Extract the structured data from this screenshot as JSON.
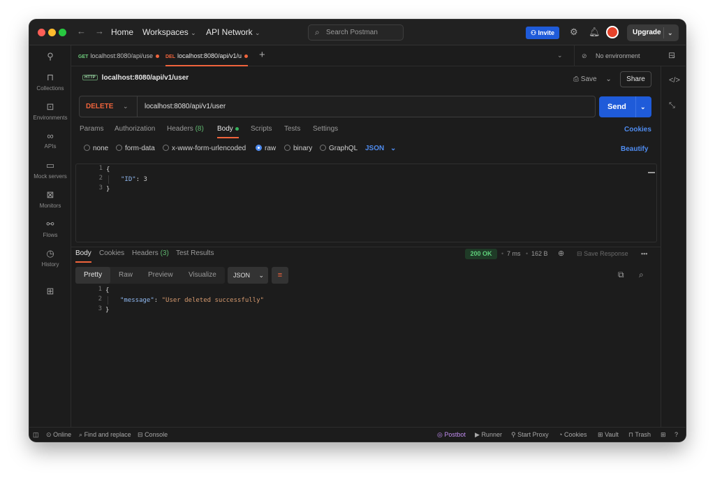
{
  "titlebar": {
    "home": "Home",
    "workspaces": "Workspaces",
    "api_network": "API Network",
    "search_placeholder": "Search Postman",
    "invite": "Invite",
    "upgrade": "Upgrade"
  },
  "sidebar": {
    "items": [
      {
        "label": "Collections"
      },
      {
        "label": "Environments"
      },
      {
        "label": "APIs"
      },
      {
        "label": "Mock servers"
      },
      {
        "label": "Monitors"
      },
      {
        "label": "Flows"
      },
      {
        "label": "History"
      }
    ]
  },
  "tabs": [
    {
      "method": "GET",
      "label": "localhost:8080/api/use"
    },
    {
      "method": "DEL",
      "label": "localhost:8080/api/v1/u"
    }
  ],
  "environment": "No environment",
  "request": {
    "title": "localhost:8080/api/v1/user",
    "title_chip": "HTTP",
    "save": "Save",
    "share": "Share",
    "method": "DELETE",
    "url": "localhost:8080/api/v1/user",
    "send": "Send"
  },
  "request_tabs": {
    "params": "Params",
    "authorization": "Authorization",
    "headers": "Headers",
    "headers_count": "(8)",
    "body": "Body",
    "scripts": "Scripts",
    "tests": "Tests",
    "settings": "Settings",
    "cookies": "Cookies"
  },
  "body_modes": {
    "none": "none",
    "form_data": "form-data",
    "urlencoded": "x-www-form-urlencoded",
    "raw": "raw",
    "binary": "binary",
    "graphql": "GraphQL",
    "format": "JSON",
    "beautify": "Beautify"
  },
  "request_body": {
    "lines": [
      "1",
      "2",
      "3"
    ],
    "open": "{",
    "key": "\"ID\"",
    "colon": ": ",
    "value": "3",
    "close": "}"
  },
  "response_tabs": {
    "body": "Body",
    "cookies": "Cookies",
    "headers": "Headers",
    "headers_count": "(3)",
    "test_results": "Test Results",
    "status": "200 OK",
    "time": "7 ms",
    "size": "162 B",
    "save_response": "Save Response"
  },
  "response_view": {
    "pretty": "Pretty",
    "raw": "Raw",
    "preview": "Preview",
    "visualize": "Visualize",
    "format": "JSON"
  },
  "response_body": {
    "lines": [
      "1",
      "2",
      "3"
    ],
    "open": "{",
    "key": "\"message\"",
    "colon": ": ",
    "value": "\"User deleted successfully\"",
    "close": "}"
  },
  "statusbar": {
    "online": "Online",
    "find_replace": "Find and replace",
    "console": "Console",
    "postbot": "Postbot",
    "runner": "Runner",
    "start_proxy": "Start Proxy",
    "cookies": "Cookies",
    "vault": "Vault",
    "trash": "Trash"
  },
  "colors": {
    "accent": "#f0643c",
    "primary": "#1f5bd9",
    "link": "#4f8cf0",
    "success": "#5fd07b"
  }
}
